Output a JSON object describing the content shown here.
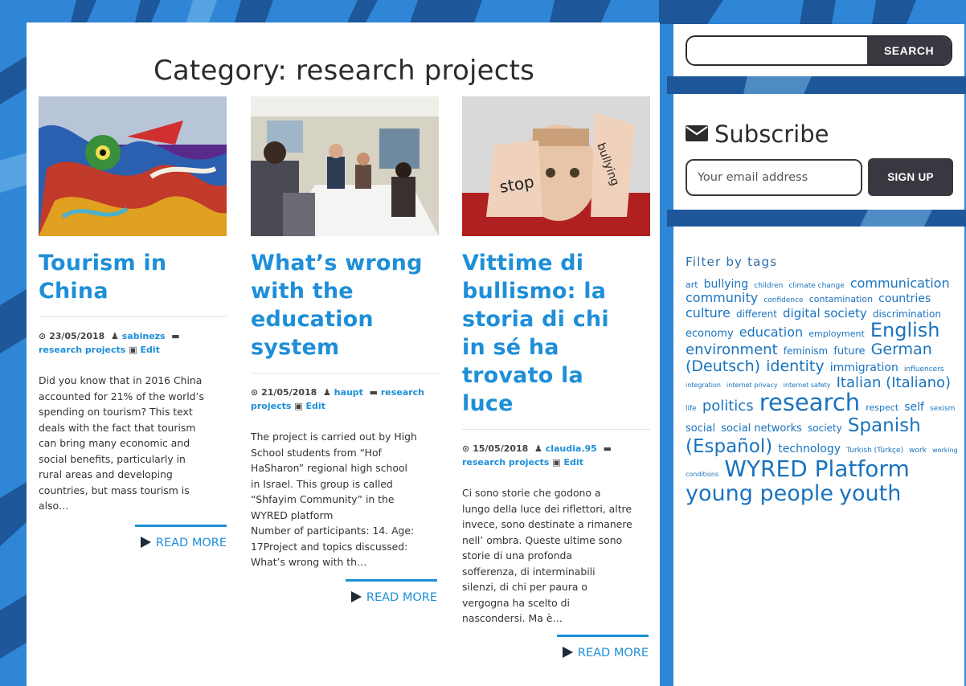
{
  "page": {
    "title": "Category: research projects"
  },
  "posts": [
    {
      "title_lines": [
        "Tourism in",
        "China"
      ],
      "image_icon": "dragon-sculpture-image",
      "date": "23/05/2018",
      "author": "sabinezs",
      "category": "research projects",
      "edit_label": "Edit",
      "excerpt": "Did you know that in 2016 China\naccounted for 21% of the world’s\nspending on tourism? This text\ndeals with the fact that tourism\ncan bring many economic and\nsocial benefits, particularly in\nrural areas and developing\ncountries, but mass tourism is\nalso…",
      "read_more": "READ MORE"
    },
    {
      "title_lines": [
        "What’s wrong",
        "with the",
        "education",
        "system"
      ],
      "image_icon": "classroom-photo",
      "date": "21/05/2018",
      "author": "haupt",
      "category": "research projects",
      "edit_label": "Edit",
      "excerpt": "The project is carried out by High\nSchool students from “Hof\nHaSharon” regional high school\nin Israel. This group is called\n“Shfayim Community” in the\nWYRED platform\nNumber of participants: 14.  Age:\n17Project and topics discussed:\nWhat’s wrong with th…",
      "read_more": "READ MORE"
    },
    {
      "title_lines": [
        "Vittime di",
        "bullismo: la",
        "storia di chi",
        "in sé ha",
        "trovato la",
        "luce"
      ],
      "image_icon": "stop-bullying-photo",
      "image_text_left": "stop",
      "image_text_right": "bullying",
      "date": "15/05/2018",
      "author": "claudia.95",
      "category": "research projects",
      "edit_label": "Edit",
      "excerpt": "Ci sono storie che godono a\nlungo della luce dei riflettori, altre\ninvece, sono destinate a rimanere\nnell’ ombra. Queste ultime sono\nstorie di una profonda\nsofferenza, di interminabili\nsilenzi, di chi per paura o\nvergogna ha scelto di\nnascondersi. Ma è…",
      "read_more": "READ MORE"
    }
  ],
  "sidebar": {
    "search": {
      "placeholder": "",
      "button": "SEARCH"
    },
    "subscribe": {
      "title": "Subscribe",
      "icon": "envelope-icon",
      "placeholder": "Your email address",
      "button": "SIGN UP"
    },
    "tags": {
      "title": "Filter by tags",
      "items": [
        {
          "label": "art",
          "size": 11
        },
        {
          "label": "bullying",
          "size": 14
        },
        {
          "label": "children",
          "size": 9
        },
        {
          "label": "climate change",
          "size": 9
        },
        {
          "label": "communication",
          "size": 16
        },
        {
          "label": "community",
          "size": 16
        },
        {
          "label": "confidence",
          "size": 9
        },
        {
          "label": "contamination",
          "size": 11
        },
        {
          "label": "countries",
          "size": 14
        },
        {
          "label": "culture",
          "size": 16
        },
        {
          "label": "different",
          "size": 12
        },
        {
          "label": "digital society",
          "size": 15
        },
        {
          "label": "discrimination",
          "size": 12
        },
        {
          "label": "economy",
          "size": 13
        },
        {
          "label": "education",
          "size": 16
        },
        {
          "label": "employment",
          "size": 11
        },
        {
          "label": "English",
          "size": 24
        },
        {
          "label": "environment",
          "size": 18
        },
        {
          "label": "feminism",
          "size": 12
        },
        {
          "label": "future",
          "size": 13
        },
        {
          "label": "German (Deutsch)",
          "size": 19
        },
        {
          "label": "identity",
          "size": 19
        },
        {
          "label": "immigration",
          "size": 14
        },
        {
          "label": "influencers",
          "size": 9
        },
        {
          "label": "integration",
          "size": 8
        },
        {
          "label": "internet privacy",
          "size": 8
        },
        {
          "label": "internet safety",
          "size": 8
        },
        {
          "label": "Italian (Italiano)",
          "size": 18
        },
        {
          "label": "life",
          "size": 9
        },
        {
          "label": "politics",
          "size": 18
        },
        {
          "label": "research",
          "size": 29
        },
        {
          "label": "respect",
          "size": 11
        },
        {
          "label": "self",
          "size": 14
        },
        {
          "label": "sexism",
          "size": 9
        },
        {
          "label": "social",
          "size": 13
        },
        {
          "label": "social networks",
          "size": 13
        },
        {
          "label": "society",
          "size": 12
        },
        {
          "label": "Spanish (Español)",
          "size": 23
        },
        {
          "label": "technology",
          "size": 14
        },
        {
          "label": "Turkish (Türkçe)",
          "size": 9
        },
        {
          "label": "work",
          "size": 9
        },
        {
          "label": "working conditions",
          "size": 8
        },
        {
          "label": "WYRED Platform",
          "size": 28
        },
        {
          "label": "young people",
          "size": 27
        },
        {
          "label": "youth",
          "size": 27
        }
      ]
    }
  },
  "colors": {
    "accent": "#1e8fd8",
    "background": "#2a7fd0",
    "button_dark": "#3b3740"
  }
}
